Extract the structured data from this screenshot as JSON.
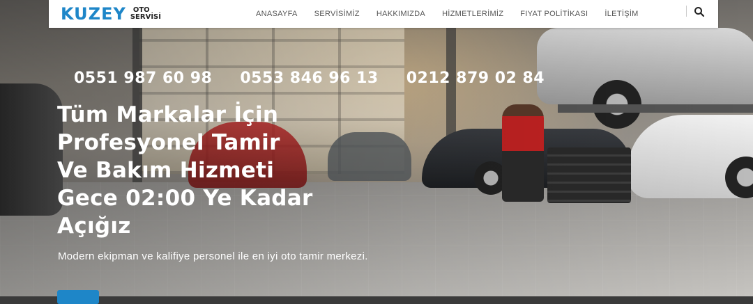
{
  "header": {
    "logo": {
      "main": "KUZEY",
      "sub_line1": "OTO",
      "sub_line2": "SERVİSİ"
    },
    "nav": [
      "ANASAYFA",
      "SERVİSİMİZ",
      "HAKKIMIZDA",
      "HİZMETLERİMİZ",
      "FIYAT POLİTİKASI",
      "İLETİŞİM"
    ],
    "search_icon": "search-icon"
  },
  "hero": {
    "phones": [
      "0551 987 60 98",
      "0553 846 96 13",
      "0212 879 02 84"
    ],
    "headline_lines": [
      "Tüm Markalar İçin",
      "Profesyonel Tamir",
      "Ve Bakım Hizmeti",
      "Gece 02:00 Ye Kadar",
      "Açığız"
    ],
    "subtext": "Modern ekipman ve kalifiye personel ile en iyi oto tamir merkezi.",
    "cta_color": "#1e86c8"
  },
  "colors": {
    "brand": "#1e86c8",
    "header_bg": "#ffffff",
    "nav_text": "#555555"
  }
}
